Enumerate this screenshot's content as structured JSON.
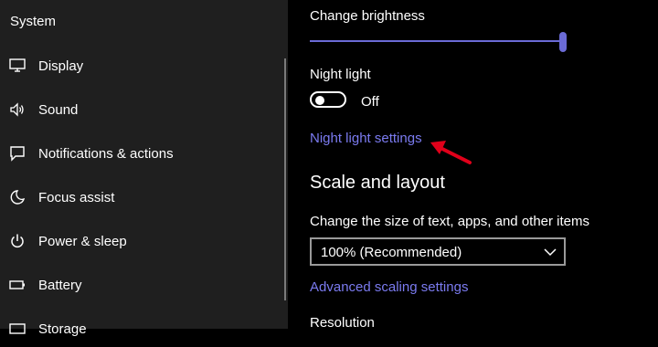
{
  "sidebar": {
    "title": "System",
    "items": [
      {
        "label": "Display",
        "icon": "display-icon"
      },
      {
        "label": "Sound",
        "icon": "speaker-icon"
      },
      {
        "label": "Notifications & actions",
        "icon": "notification-icon"
      },
      {
        "label": "Focus assist",
        "icon": "moon-icon"
      },
      {
        "label": "Power & sleep",
        "icon": "power-icon"
      },
      {
        "label": "Battery",
        "icon": "battery-icon"
      },
      {
        "label": "Storage",
        "icon": "storage-icon"
      }
    ]
  },
  "main": {
    "brightness": {
      "label": "Change brightness",
      "value_percent": 100
    },
    "night_light": {
      "label": "Night light",
      "state": "Off",
      "settings_link": "Night light settings"
    },
    "scale_layout": {
      "heading": "Scale and layout",
      "size_label": "Change the size of text, apps, and other items",
      "size_value": "100% (Recommended)",
      "advanced_link": "Advanced scaling settings",
      "resolution_label": "Resolution"
    }
  },
  "colors": {
    "accent": "#7b7bf0",
    "annotation_arrow": "#e0001a",
    "sidebar_bg": "#1f1f1f"
  }
}
